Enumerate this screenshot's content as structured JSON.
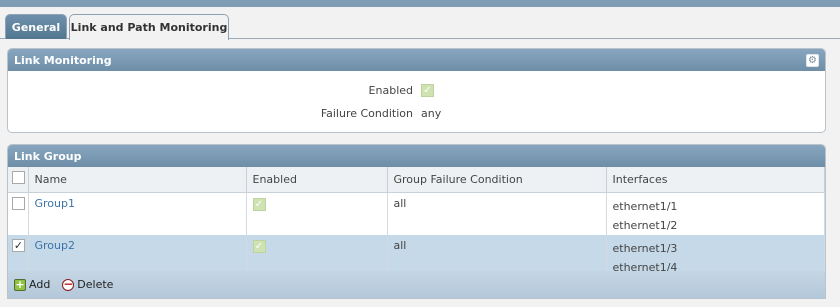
{
  "tabs": [
    {
      "label": "General",
      "active": true
    },
    {
      "label": "Link and Path Monitoring",
      "active": false
    }
  ],
  "link_monitoring": {
    "title": "Link Monitoring",
    "settings_icon": "gear-icon",
    "enabled_label": "Enabled",
    "enabled": true,
    "failure_label": "Failure Condition",
    "failure_value": "any"
  },
  "link_group": {
    "title": "Link Group",
    "columns": [
      "Name",
      "Enabled",
      "Group Failure Condition",
      "Interfaces"
    ],
    "rows": [
      {
        "selected": false,
        "name": "Group1",
        "enabled": true,
        "condition": "all",
        "interfaces": [
          "ethernet1/1",
          "ethernet1/2"
        ]
      },
      {
        "selected": true,
        "name": "Group2",
        "enabled": true,
        "condition": "all",
        "interfaces": [
          "ethernet1/3",
          "ethernet1/4"
        ]
      }
    ],
    "add_label": "Add",
    "delete_label": "Delete"
  },
  "colors": {
    "header": "#7f9db5",
    "selected_row": "#c6d9e8",
    "link": "#3b74a8"
  }
}
